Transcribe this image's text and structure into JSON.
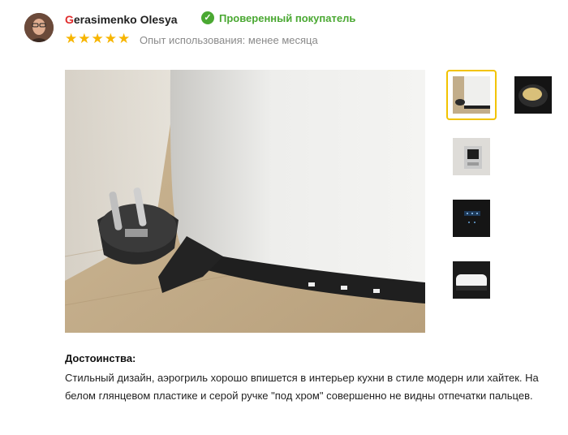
{
  "review": {
    "author_first_letter": "G",
    "author_rest": "erasimenko Olesya",
    "verified_label": "Проверенный покупатель",
    "rating": 5,
    "stars": [
      "★",
      "★",
      "★",
      "★",
      "★"
    ],
    "experience": "Опыт использования: менее месяца"
  },
  "photos": {
    "main_label": "photo-main",
    "thumbnails": [
      "photo-1",
      "photo-2",
      "photo-3",
      "photo-4",
      "photo-5"
    ],
    "selected_index": 0
  },
  "pros": {
    "title": "Достоинства:",
    "text": "Стильный дизайн, аэрогриль хорошо впишется в интерьер кухни в стиле модерн или хайтек. На белом глянцевом пластике и серой ручке \"под хром\" совершенно не видны отпечатки пальцев."
  },
  "colors": {
    "accent_red": "#e02d2d",
    "verified_green": "#4aa832",
    "star_yellow": "#f7b500",
    "selected_border": "#f2c300"
  }
}
